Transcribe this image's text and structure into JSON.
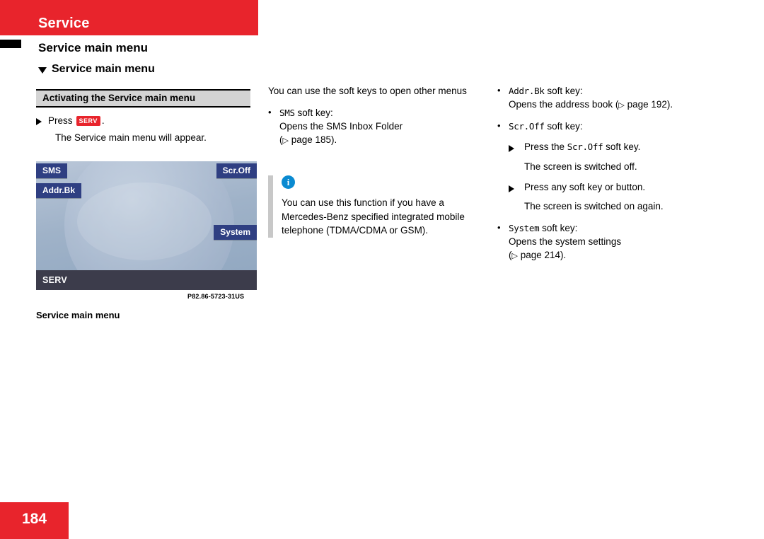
{
  "header": {
    "title": "Service",
    "chapter": "Service main menu",
    "section": "Service main menu"
  },
  "col1": {
    "gray_heading": "Activating the Service main menu",
    "press_label": "Press",
    "serv_key": "SERV",
    "press_period": ".",
    "result": "The Service main menu will appear.",
    "figure_code": "P82.86-5723-31US",
    "figure_caption": "Service main menu",
    "screen": {
      "softkey_sms": "SMS",
      "softkey_addr": "Addr.Bk",
      "softkey_scroff": "Scr.Off",
      "softkey_system": "System",
      "footer": "SERV"
    }
  },
  "col2": {
    "intro": "You can use the soft keys to open other menus",
    "bullet1_key": "SMS",
    "bullet1_suffix": " soft key:",
    "bullet1_line1": "Opens the SMS Inbox Folder",
    "bullet1_line2_prefix": "(",
    "bullet1_line2_arrow": "▷",
    "bullet1_line2_text": " page 185).",
    "note_icon": "i",
    "note_text": "You can use this function if you have a Mercedes-Benz specified integrated mobile telephone (TDMA/CDMA or GSM)."
  },
  "col3": {
    "bullet1_key": "Addr.Bk",
    "bullet1_suffix": " soft key:",
    "bullet1_line1_text": "Opens the address book (",
    "bullet1_line1_arrow": "▷",
    "bullet1_line1_tail": " page 192).",
    "bullet2_key": "Scr.Off",
    "bullet2_suffix": " soft key:",
    "bullet2_step1_prefix": "Press the ",
    "bullet2_step1_key": "Scr.Off",
    "bullet2_step1_suffix": " soft key.",
    "bullet2_result1": "The screen is switched off.",
    "bullet2_step2": "Press any soft key or button.",
    "bullet2_result2": "The screen is switched on again.",
    "bullet3_key": "System",
    "bullet3_suffix": " soft key:",
    "bullet3_line1": "Opens the system settings",
    "bullet3_line2_prefix": "(",
    "bullet3_line2_arrow": "▷",
    "bullet3_line2_text": " page 214).",
    "bullet_dot": "•"
  },
  "footer": {
    "page_number": "184"
  },
  "colors": {
    "accent_red": "#e8242c",
    "softkey_blue": "#2f3f82",
    "note_blue": "#0a8ad1"
  }
}
